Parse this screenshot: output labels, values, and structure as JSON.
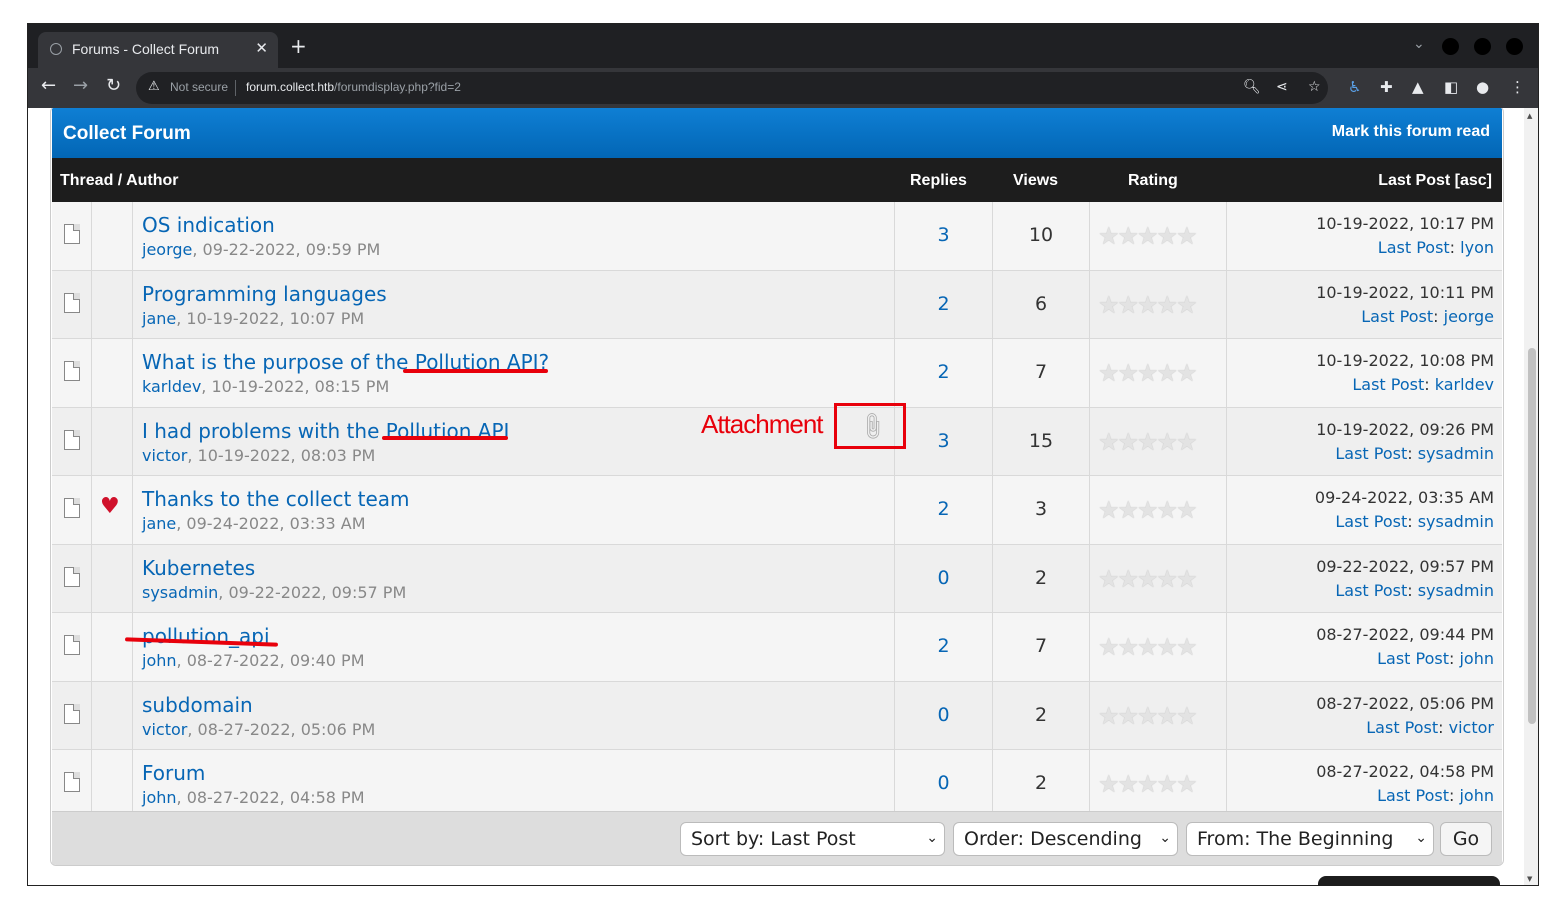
{
  "browser": {
    "tab_title": "Forums - Collect Forum",
    "close_glyph": "✕",
    "new_tab_glyph": "+",
    "security_label": "Not secure",
    "url_host": "forum.collect.htb",
    "url_path": "/forumdisplay.php?fid=2"
  },
  "forum": {
    "title": "Collect Forum",
    "mark_read": "Mark this forum read",
    "columns": {
      "thread": "Thread / Author",
      "replies": "Replies",
      "views": "Views",
      "rating": "Rating",
      "last_post": "Last Post [asc]"
    },
    "threads": [
      {
        "subject": "OS indication",
        "author": "jeorge",
        "date": "09-22-2022, 09:59 PM",
        "replies": "3",
        "views": "10",
        "last_date": "10-19-2022, 10:17 PM",
        "last_label": "Last Post",
        "last_user": "lyon",
        "prefix": ""
      },
      {
        "subject": "Programming languages",
        "author": "jane",
        "date": "10-19-2022, 10:07 PM",
        "replies": "2",
        "views": "6",
        "last_date": "10-19-2022, 10:11 PM",
        "last_label": "Last Post",
        "last_user": "jeorge",
        "prefix": ""
      },
      {
        "subject": "What is the purpose of the Pollution API?",
        "author": "karldev",
        "date": "10-19-2022, 08:15 PM",
        "replies": "2",
        "views": "7",
        "last_date": "10-19-2022, 10:08 PM",
        "last_label": "Last Post",
        "last_user": "karldev",
        "prefix": ""
      },
      {
        "subject": "I had problems with the Pollution API",
        "author": "victor",
        "date": "10-19-2022, 08:03 PM",
        "replies": "3",
        "views": "15",
        "last_date": "10-19-2022, 09:26 PM",
        "last_label": "Last Post",
        "last_user": "sysadmin",
        "prefix": ""
      },
      {
        "subject": "Thanks to the collect team",
        "author": "jane",
        "date": "09-24-2022, 03:33 AM",
        "replies": "2",
        "views": "3",
        "last_date": "09-24-2022, 03:35 AM",
        "last_label": "Last Post",
        "last_user": "sysadmin",
        "prefix": "heart"
      },
      {
        "subject": "Kubernetes",
        "author": "sysadmin",
        "date": "09-22-2022, 09:57 PM",
        "replies": "0",
        "views": "2",
        "last_date": "09-22-2022, 09:57 PM",
        "last_label": "Last Post",
        "last_user": "sysadmin",
        "prefix": ""
      },
      {
        "subject": "pollution_api",
        "author": "john",
        "date": "08-27-2022, 09:40 PM",
        "replies": "2",
        "views": "7",
        "last_date": "08-27-2022, 09:44 PM",
        "last_label": "Last Post",
        "last_user": "john",
        "prefix": ""
      },
      {
        "subject": "subdomain",
        "author": "victor",
        "date": "08-27-2022, 05:06 PM",
        "replies": "0",
        "views": "2",
        "last_date": "08-27-2022, 05:06 PM",
        "last_label": "Last Post",
        "last_user": "victor",
        "prefix": ""
      },
      {
        "subject": "Forum",
        "author": "john",
        "date": "08-27-2022, 04:58 PM",
        "replies": "0",
        "views": "2",
        "last_date": "08-27-2022, 04:58 PM",
        "last_label": "Last Post",
        "last_user": "john",
        "prefix": ""
      }
    ],
    "footer": {
      "sort_by": "Sort by: Last Post",
      "order": "Order: Descending",
      "from": "From: The Beginning",
      "go": "Go"
    }
  },
  "annotation": {
    "label": "Attachment",
    "color": "#e8000b"
  },
  "colors": {
    "forum_blue": "#0766b5",
    "header_dark": "#1d1d1d",
    "heart_red": "#d0112b"
  }
}
